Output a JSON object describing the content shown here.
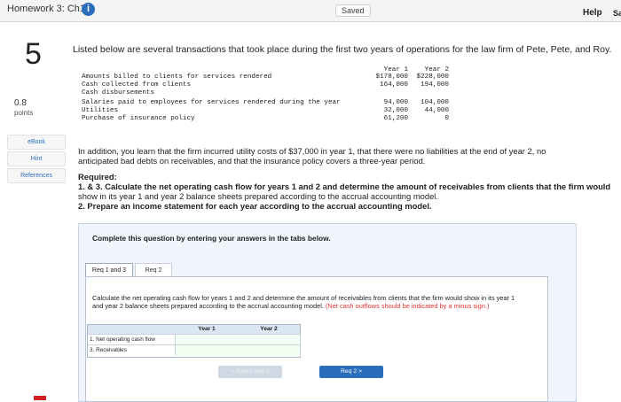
{
  "header": {
    "title": "Homework 3: Ch1",
    "info_icon": "i",
    "saved": "Saved",
    "help": "Help",
    "save_truncated": "Sa"
  },
  "question": {
    "number": "5",
    "points_value": "0.8",
    "points_label": "points",
    "intro": "Listed below are several transactions that took place during the first two years of operations for the law firm of Pete, Pete, and Roy.",
    "transactions": {
      "col_year1": "Year 1",
      "col_year2": "Year 2",
      "rows": [
        {
          "label": "Amounts billed to clients for services rendered",
          "y1": "$178,000",
          "y2": "$228,000"
        },
        {
          "label": "Cash collected from clients",
          "y1": "164,000",
          "y2": "194,000"
        },
        {
          "label": "Cash disbursements",
          "y1": "",
          "y2": ""
        },
        {
          "label": "Salaries paid to employees for services rendered during the year",
          "y1": "94,000",
          "y2": "104,000"
        },
        {
          "label": "Utilities",
          "y1": "32,000",
          "y2": "44,000"
        },
        {
          "label": "Purchase of insurance policy",
          "y1": "61,200",
          "y2": "0"
        }
      ]
    },
    "para1_line1": "In addition, you learn that the firm incurred utility costs of $37,000 in year 1, that there were no liabilities at the end of year 2, no",
    "para1_line2": "anticipated bad debts on receivables, and that the insurance policy covers a three-year period.",
    "required_label": "Required:",
    "req1_line1": "1. & 3. Calculate the net operating cash flow for years 1 and 2 and determine the amount of receivables from clients that the firm would",
    "req1_line2": "show in its year 1 and year 2 balance sheets prepared according to the accrual accounting model.",
    "req2": "2. Prepare an income statement for each year according to the accrual accounting model."
  },
  "sidebar": {
    "ebook": "eBook",
    "hint": "Hint",
    "references": "References"
  },
  "panel": {
    "complete_label": "Complete this question by entering your answers in the tabs below.",
    "tabs": [
      "Req 1 and 3",
      "Req 2"
    ],
    "instruction": "Calculate the net operating cash flow for years 1 and 2 and determine the amount of receivables from clients that the firm would show in its year 1 and year 2 balance sheets prepared according to the accrual accounting model.",
    "note": "(Net cash outflows should be indicated by a minus sign.)",
    "grid": {
      "col1": "Year 1",
      "col2": "Year 2",
      "rows": [
        "1.  Net operating cash flow",
        "3.  Receivables"
      ]
    },
    "prev_button": "< Req 1 and 3",
    "next_button": "Req 2  >"
  },
  "colors": {
    "accent": "#2a6ebb",
    "panel_bg": "#f1f5fb",
    "note": "#d33333"
  }
}
